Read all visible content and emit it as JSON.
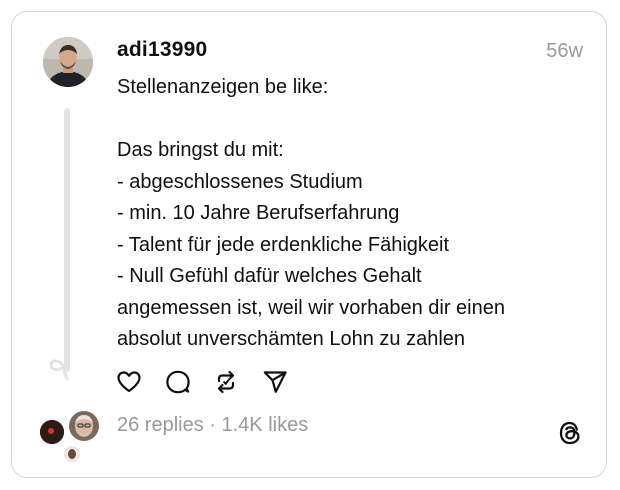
{
  "post": {
    "username": "adi13990",
    "time": "56w",
    "lines": [
      "Stellenanzeigen be like:",
      "",
      "Das bringst du mit:",
      "- abgeschlossenes Studium",
      "- min. 10 Jahre Berufserfahrung",
      "- Talent für jede erdenkliche Fähigkeit",
      "- Null Gefühl dafür welches Gehalt",
      "angemessen ist, weil wir vorhaben dir einen",
      "absolut unverschämten Lohn zu zahlen"
    ],
    "stats": "26 replies · 1.4K likes"
  },
  "actions": [
    {
      "icon": "heart-icon"
    },
    {
      "icon": "comment-icon"
    },
    {
      "icon": "repost-icon"
    },
    {
      "icon": "share-icon"
    }
  ],
  "colors": {
    "text": "#101010",
    "muted": "#999999",
    "border": "#d6d6d6",
    "thread_line": "#e3e3e3"
  },
  "brand": {
    "icon": "threads-logo-icon"
  }
}
